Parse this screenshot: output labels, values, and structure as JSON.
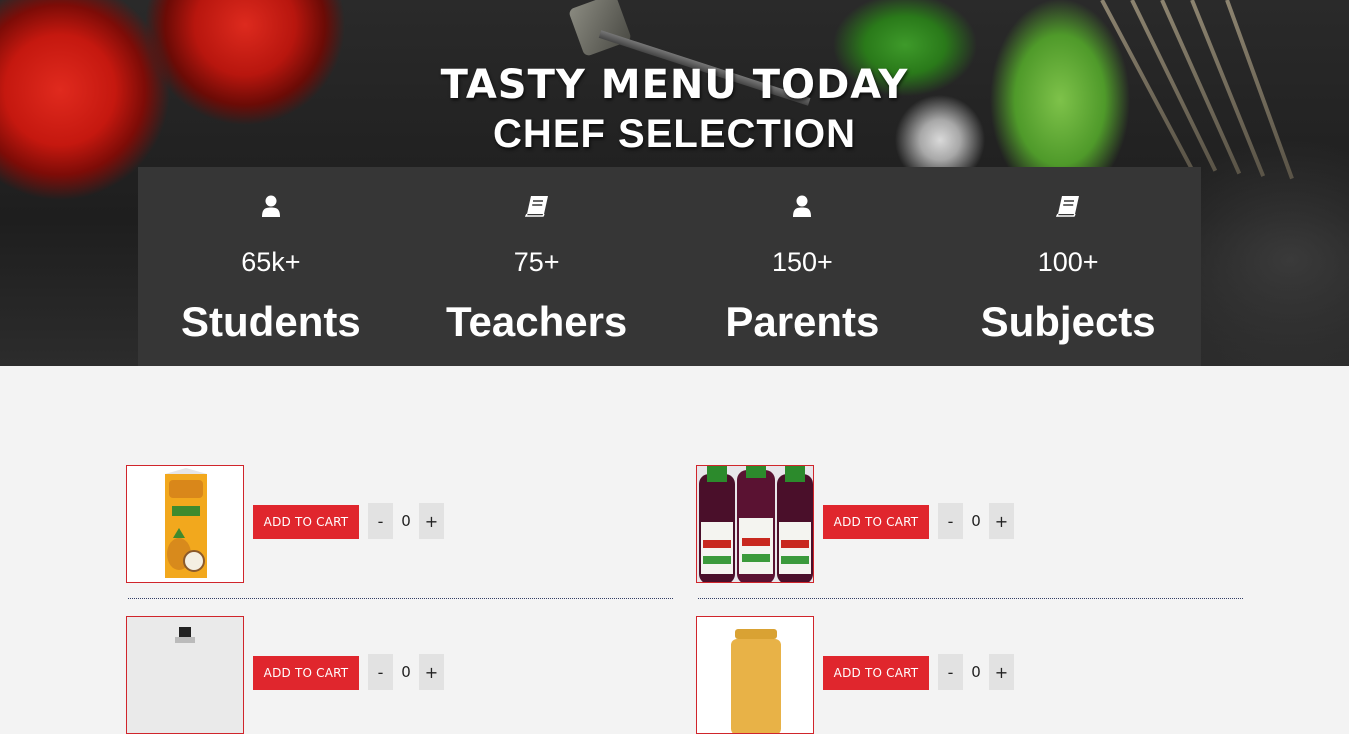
{
  "hero": {
    "title": "TASTY MENU TODAY",
    "subtitle": "CHEF SELECTION"
  },
  "stats": [
    {
      "icon": "user-icon",
      "number": "65k+",
      "label": "Students"
    },
    {
      "icon": "book-icon",
      "number": "75+",
      "label": "Teachers"
    },
    {
      "icon": "user-icon",
      "number": "150+",
      "label": "Parents"
    },
    {
      "icon": "book-icon",
      "number": "100+",
      "label": "Subjects"
    }
  ],
  "products": [
    {
      "image": "juice-carton-image",
      "add_label": "ADD TO CART",
      "minus": "-",
      "qty": "0",
      "plus": "+"
    },
    {
      "image": "zobo-bottles-image",
      "add_label": "ADD TO CART",
      "minus": "-",
      "qty": "0",
      "plus": "+"
    },
    {
      "image": "product-image",
      "add_label": "ADD TO CART",
      "minus": "-",
      "qty": "0",
      "plus": "+"
    },
    {
      "image": "product-image",
      "add_label": "ADD TO CART",
      "minus": "-",
      "qty": "0",
      "plus": "+"
    }
  ],
  "colors": {
    "accent": "#e0262d",
    "panel": "#363636",
    "background": "#f3f3f3"
  }
}
